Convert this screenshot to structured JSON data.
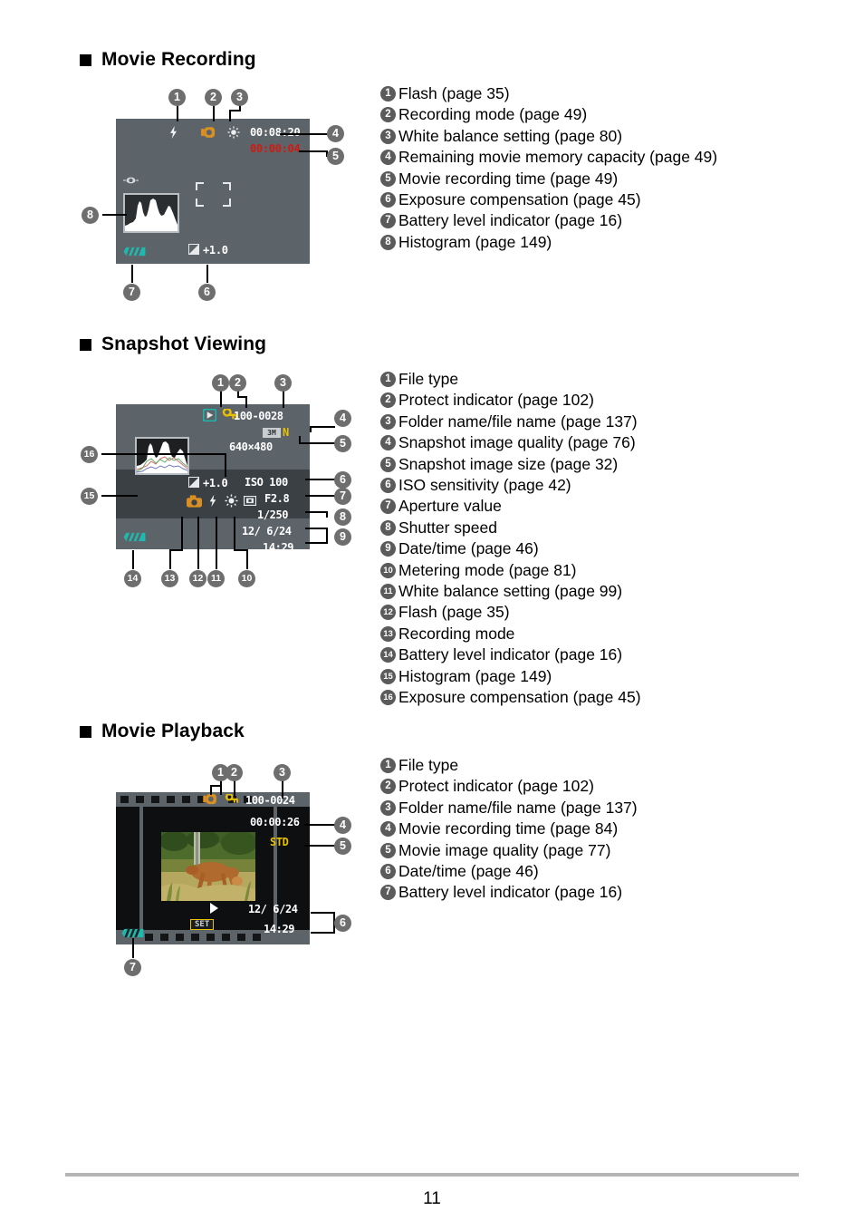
{
  "page": {
    "number": "11"
  },
  "sections": [
    {
      "id": "movie-recording",
      "heading": "Movie Recording",
      "screen": {
        "remaining_capacity": "00:08:20",
        "recording_time": "00:00:04",
        "exposure_compensation": "+1.0",
        "icons": [
          "flash-icon",
          "recording-mode-icon",
          "white-balance-icon",
          "anti-shake-icon",
          "battery-icon",
          "histogram"
        ]
      },
      "legend": [
        {
          "num": "1",
          "text": "Flash (page 35)"
        },
        {
          "num": "2",
          "text": "Recording mode (page 49)"
        },
        {
          "num": "3",
          "text": "White balance setting (page 80)"
        },
        {
          "num": "4",
          "text": "Remaining movie memory capacity (page 49)"
        },
        {
          "num": "5",
          "text": "Movie recording time (page 49)"
        },
        {
          "num": "6",
          "text": "Exposure compensation (page 45)"
        },
        {
          "num": "7",
          "text": "Battery level indicator (page 16)"
        },
        {
          "num": "8",
          "text": "Histogram (page 149)"
        }
      ]
    },
    {
      "id": "snapshot-viewing",
      "heading": "Snapshot Viewing",
      "screen": {
        "folder_file": "100-0028",
        "image_quality_tag": "3M",
        "image_quality_letter": "N",
        "image_size": "640×480",
        "exposure_compensation": "+1.0",
        "iso": "ISO 100",
        "aperture": "F2.8",
        "shutter_speed": "1/250",
        "date": "12/ 6/24",
        "time": "14:29"
      },
      "legend": [
        {
          "num": "1",
          "text": "File type"
        },
        {
          "num": "2",
          "text": "Protect indicator (page 102)"
        },
        {
          "num": "3",
          "text": "Folder name/file name (page 137)"
        },
        {
          "num": "4",
          "text": "Snapshot image quality (page 76)"
        },
        {
          "num": "5",
          "text": "Snapshot image size (page 32)"
        },
        {
          "num": "6",
          "text": "ISO sensitivity (page 42)"
        },
        {
          "num": "7",
          "text": "Aperture value"
        },
        {
          "num": "8",
          "text": "Shutter speed"
        },
        {
          "num": "9",
          "text": "Date/time (page 46)"
        },
        {
          "num": "10",
          "text": "Metering mode (page 81)"
        },
        {
          "num": "11",
          "text": "White balance setting (page 99)"
        },
        {
          "num": "12",
          "text": "Flash (page 35)"
        },
        {
          "num": "13",
          "text": "Recording mode"
        },
        {
          "num": "14",
          "text": "Battery level indicator (page 16)"
        },
        {
          "num": "15",
          "text": "Histogram (page 149)"
        },
        {
          "num": "16",
          "text": "Exposure compensation (page 45)"
        }
      ]
    },
    {
      "id": "movie-playback",
      "heading": "Movie Playback",
      "screen": {
        "folder_file": "100-0024",
        "recording_time": "00:00:26",
        "image_quality": "STD",
        "date": "12/ 6/24",
        "time": "14:29",
        "set_label": "SET"
      },
      "legend": [
        {
          "num": "1",
          "text": "File type"
        },
        {
          "num": "2",
          "text": "Protect indicator (page 102)"
        },
        {
          "num": "3",
          "text": "Folder name/file name (page 137)"
        },
        {
          "num": "4",
          "text": "Movie recording time (page 84)"
        },
        {
          "num": "5",
          "text": "Movie image quality (page 77)"
        },
        {
          "num": "6",
          "text": "Date/time (page 46)"
        },
        {
          "num": "7",
          "text": "Battery level indicator (page 16)"
        }
      ]
    }
  ],
  "callouts": {
    "rec": [
      "1",
      "2",
      "3",
      "4",
      "5",
      "6",
      "7",
      "8"
    ],
    "snap": [
      "1",
      "2",
      "3",
      "4",
      "5",
      "6",
      "7",
      "8",
      "9",
      "10",
      "11",
      "12",
      "13",
      "14",
      "15",
      "16"
    ],
    "play": [
      "1",
      "2",
      "3",
      "4",
      "5",
      "6",
      "7"
    ]
  },
  "colors": {
    "lcd_background": "#5d6469",
    "badge": "#5b5b5b",
    "callout": "#6e6e6e",
    "rec_red": "#d01a10",
    "amber": "#e9c000",
    "battery_teal": "#1fb8ae",
    "rule": "#b5b5b5"
  }
}
